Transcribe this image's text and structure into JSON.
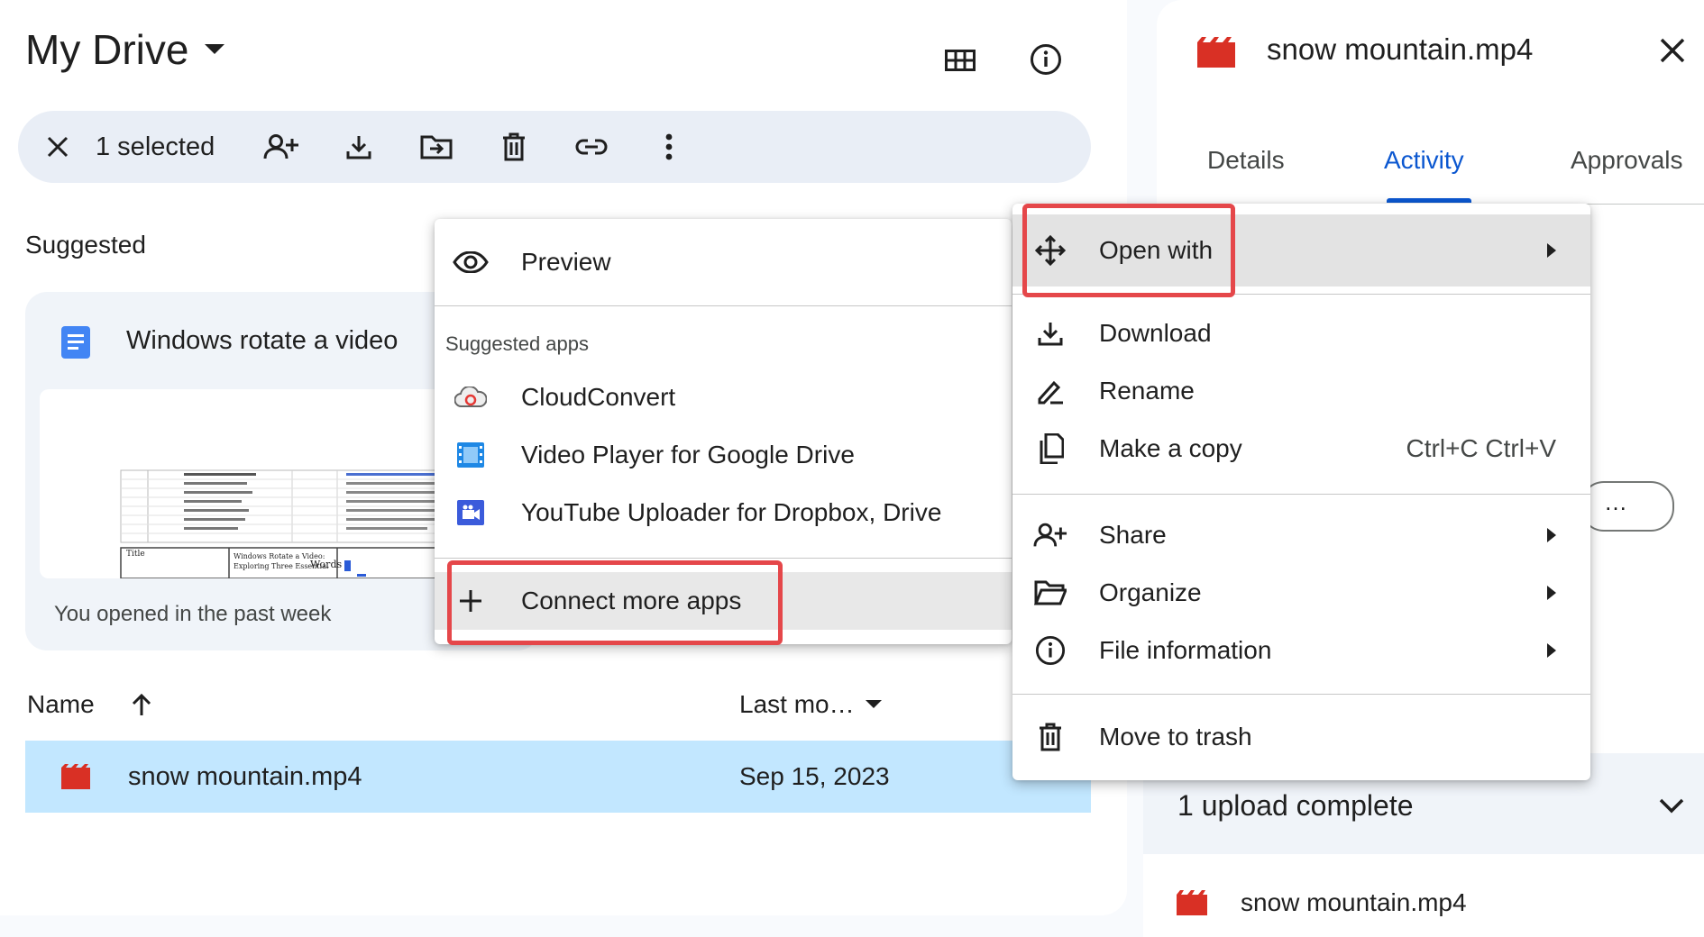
{
  "main": {
    "title": "My Drive",
    "selection_count": "1 selected",
    "suggested_label": "Suggested",
    "suggested_card": {
      "title": "Windows rotate a video",
      "subtitle": "You opened in the past week",
      "thumb_title_label": "Title",
      "thumb_doc_title": "Windows Rotate a Video: Exploring Three Essential",
      "thumb_words_label": "Words"
    },
    "columns": {
      "name": "Name",
      "modified": "Last mo…"
    },
    "file": {
      "name": "snow mountain.mp4",
      "date": "Sep 15, 2023"
    }
  },
  "details_panel": {
    "title": "snow mountain.mp4",
    "tabs": [
      "Details",
      "Activity",
      "Approvals"
    ],
    "partial_button_label": "…"
  },
  "upload_panel": {
    "title": "1 upload complete",
    "file_name": "snow mountain.mp4"
  },
  "submenu": {
    "preview": "Preview",
    "suggested_apps_label": "Suggested apps",
    "apps": [
      "CloudConvert",
      "Video Player for Google Drive",
      "YouTube Uploader for Dropbox, Drive"
    ],
    "connect_more": "Connect more apps"
  },
  "context_menu": {
    "open_with": "Open with",
    "download": "Download",
    "rename": "Rename",
    "make_copy": "Make a copy",
    "make_copy_shortcut": "Ctrl+C Ctrl+V",
    "share": "Share",
    "organize": "Organize",
    "file_information": "File information",
    "move_to_trash": "Move to trash"
  },
  "colors": {
    "accent_blue": "#0b57d0",
    "selected_row": "#c2e7ff",
    "highlight_red": "#e5474a",
    "video_icon_red": "#d93025"
  }
}
